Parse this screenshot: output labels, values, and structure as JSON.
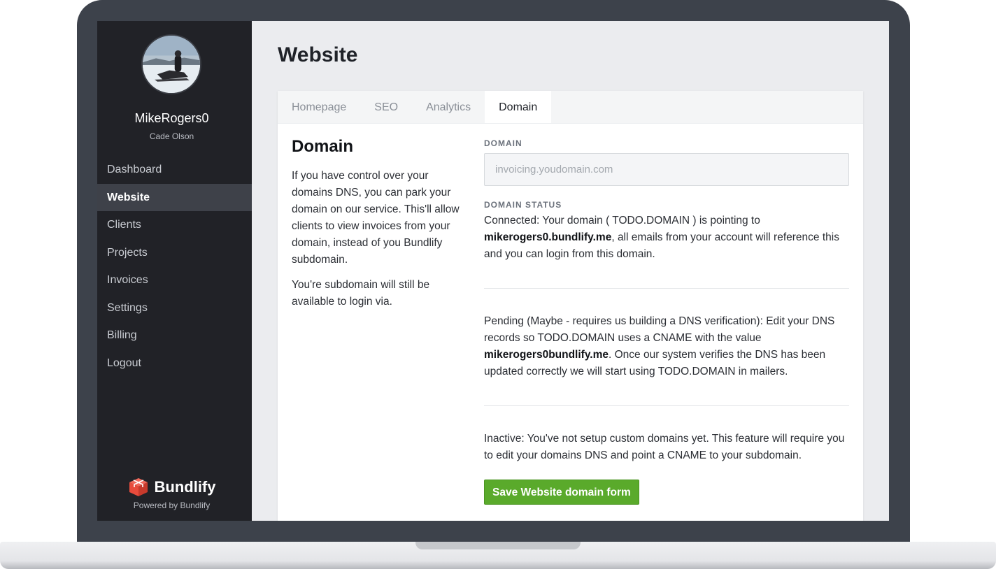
{
  "sidebar": {
    "user_name": "MikeRogers0",
    "user_subtitle": "Cade Olson",
    "nav": [
      {
        "label": "Dashboard",
        "active": false
      },
      {
        "label": "Website",
        "active": true
      },
      {
        "label": "Clients",
        "active": false
      },
      {
        "label": "Projects",
        "active": false
      },
      {
        "label": "Invoices",
        "active": false
      },
      {
        "label": "Settings",
        "active": false
      },
      {
        "label": "Billing",
        "active": false
      },
      {
        "label": "Logout",
        "active": false
      }
    ],
    "brand_name": "Bundlify",
    "brand_powered": "Powered by Bundlify"
  },
  "page": {
    "title": "Website",
    "tabs": [
      {
        "label": "Homepage",
        "active": false
      },
      {
        "label": "SEO",
        "active": false
      },
      {
        "label": "Analytics",
        "active": false
      },
      {
        "label": "Domain",
        "active": true
      }
    ]
  },
  "domain_section": {
    "title": "Domain",
    "intro": "If you have control over your domains DNS, you can park your domain on our service. This'll allow clients to view invoices from your domain, instead of you Bundlify subdomain.",
    "note": "You're subdomain will still be available to login via.",
    "field_label": "DOMAIN",
    "input_value": "",
    "input_placeholder": "invoicing.youdomain.com",
    "status_label": "DOMAIN STATUS",
    "connected": {
      "prefix": "Connected: Your domain ( TODO.DOMAIN ) is pointing to ",
      "bold": "mikerogers0.bundlify.me",
      "suffix": ", all emails from your account will reference this and you can login from this domain."
    },
    "pending": {
      "prefix": "Pending (Maybe - requires us building a DNS verification): Edit your DNS records so TODO.DOMAIN uses a CNAME with the value ",
      "bold": "mikerogers0bundlify.me",
      "suffix": ". Once our system verifies the DNS has been updated correctly we will start using TODO.DOMAIN in mailers."
    },
    "inactive": "Inactive: You've not setup custom domains yet. This feature will require you to edit your domains DNS and point a CNAME to your subdomain.",
    "save_label": "Save Website domain form"
  },
  "colors": {
    "sidebar_bg": "#212227",
    "sidebar_active": "#3e4149",
    "save_button": "#5aaa2b",
    "brand_logo": "#e84b3c"
  },
  "icons": {
    "brand": "box-logo-icon",
    "avatar": "user-avatar-photo"
  }
}
